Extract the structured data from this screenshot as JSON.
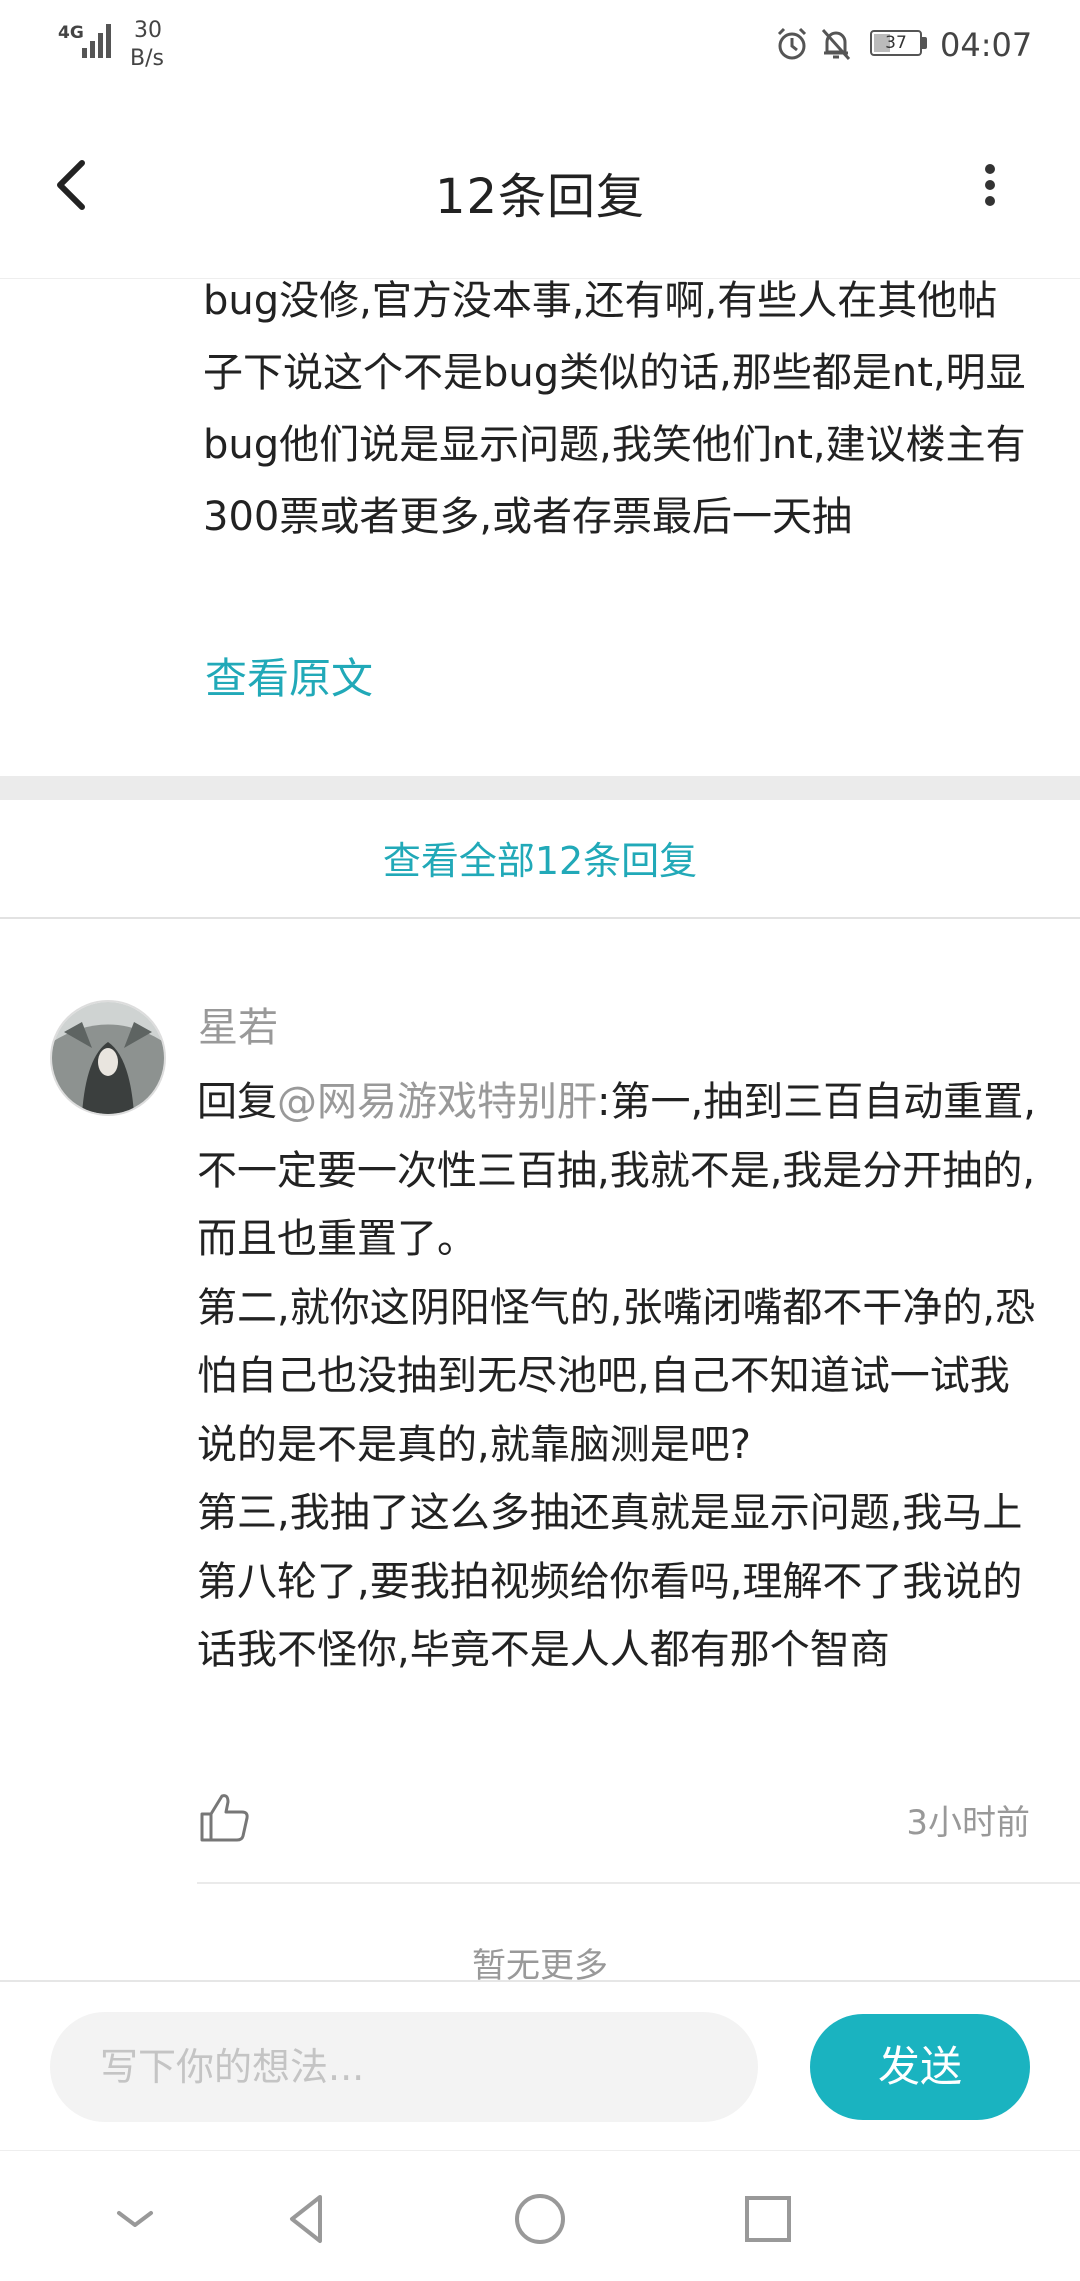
{
  "status_bar": {
    "network": "4G",
    "speed_value": "30",
    "speed_unit": "B/s",
    "battery": "37",
    "time": "04:07",
    "icons": [
      "signal-icon",
      "alarm-icon",
      "bell-off-icon",
      "battery-icon"
    ]
  },
  "header": {
    "title": "12条回复",
    "back_icon": "back-arrow-icon",
    "more_icon": "more-vertical-icon"
  },
  "quoted": {
    "text": "bug没修,官方没本事,还有啊,有些人在其他帖子下说这个不是bug类似的话,那些都是nt,明显bug他们说是显示问题,我笑他们nt,建议楼主有300票或者更多,或者存票最后一天抽",
    "view_original": "查看原文"
  },
  "view_all": "查看全部12条回复",
  "reply": {
    "username": "星若",
    "reply_prefix": "回复",
    "mention": "@网易游戏特别肝",
    "body": ":第一,抽到三百自动重置,不一定要一次性三百抽,我就不是,我是分开抽的,而且也重置了。\n第二,就你这阴阳怪气的,张嘴闭嘴都不干净的,恐怕自己也没抽到无尽池吧,自己不知道试一试我说的是不是真的,就靠脑测是吧?\n第三,我抽了这么多抽还真就是显示问题,我马上第八轮了,要我拍视频给你看吗,理解不了我说的话我不怪你,毕竟不是人人都有那个智商",
    "time": "3小时前",
    "like_icon": "thumbs-up-icon"
  },
  "no_more": "暂无更多",
  "composer": {
    "placeholder": "写下你的想法...",
    "send_label": "发送"
  },
  "colors": {
    "accent": "#1ab3c0",
    "link": "#21a9b8",
    "muted": "#999999"
  },
  "nav": [
    "hide-keyboard-icon",
    "back-triangle-icon",
    "home-circle-icon",
    "recents-square-icon"
  ]
}
